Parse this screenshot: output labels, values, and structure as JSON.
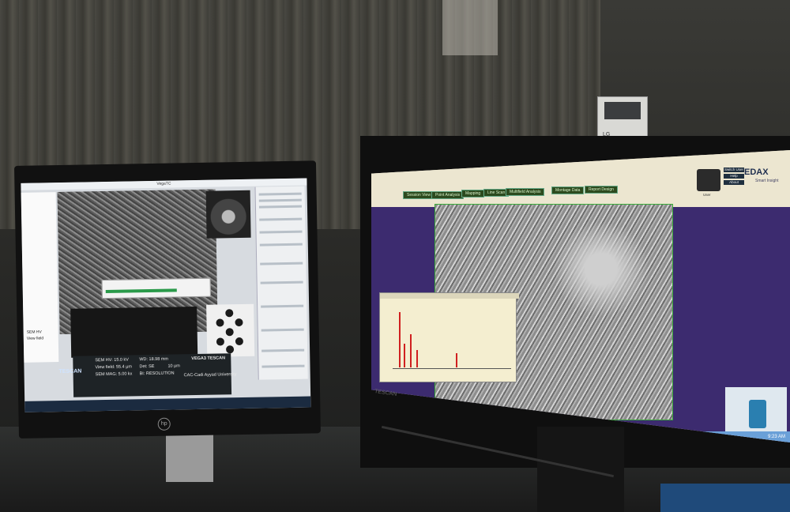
{
  "scene": "desk",
  "left_monitor": {
    "window_title": "VegaTC",
    "left_panel": {
      "hv": "SEM HV",
      "view": "View field"
    },
    "info_bar": {
      "hv": "SEM HV: 15.0 kV",
      "wd": "WD: 18.98 mm",
      "view_field": "View field: 55.4 μm",
      "det": "Det: SE",
      "mag": "SEM MAG: 5.00 kx",
      "bi": "BI: RESOLUTION",
      "scale": "10 μm",
      "model": "VEGA3 TESCAN",
      "org": "CAC-Cadi Ayyad University"
    },
    "brand": "TESCAN",
    "monitor_logo": "hp"
  },
  "right_monitor": {
    "header": {
      "logo": "EDAX",
      "tagline": "Smart Insight",
      "user_label": "User"
    },
    "side_buttons": [
      "Switch User",
      "Help",
      "About"
    ],
    "tabs": [
      "Session View",
      "Point Analysis",
      "Mapping",
      "Line Scan",
      "Multifield Analysis",
      "Montage Data",
      "Report Design"
    ],
    "time": "9:23 AM",
    "monitor_brand": "TESCAN"
  },
  "wall_device": {
    "brand": "LG"
  },
  "colors": {
    "edax_header": "#ece6d0",
    "workarea": "#3c2b6f",
    "tab_green": "#2c4a1e",
    "spectrum_peak": "#d02020"
  }
}
